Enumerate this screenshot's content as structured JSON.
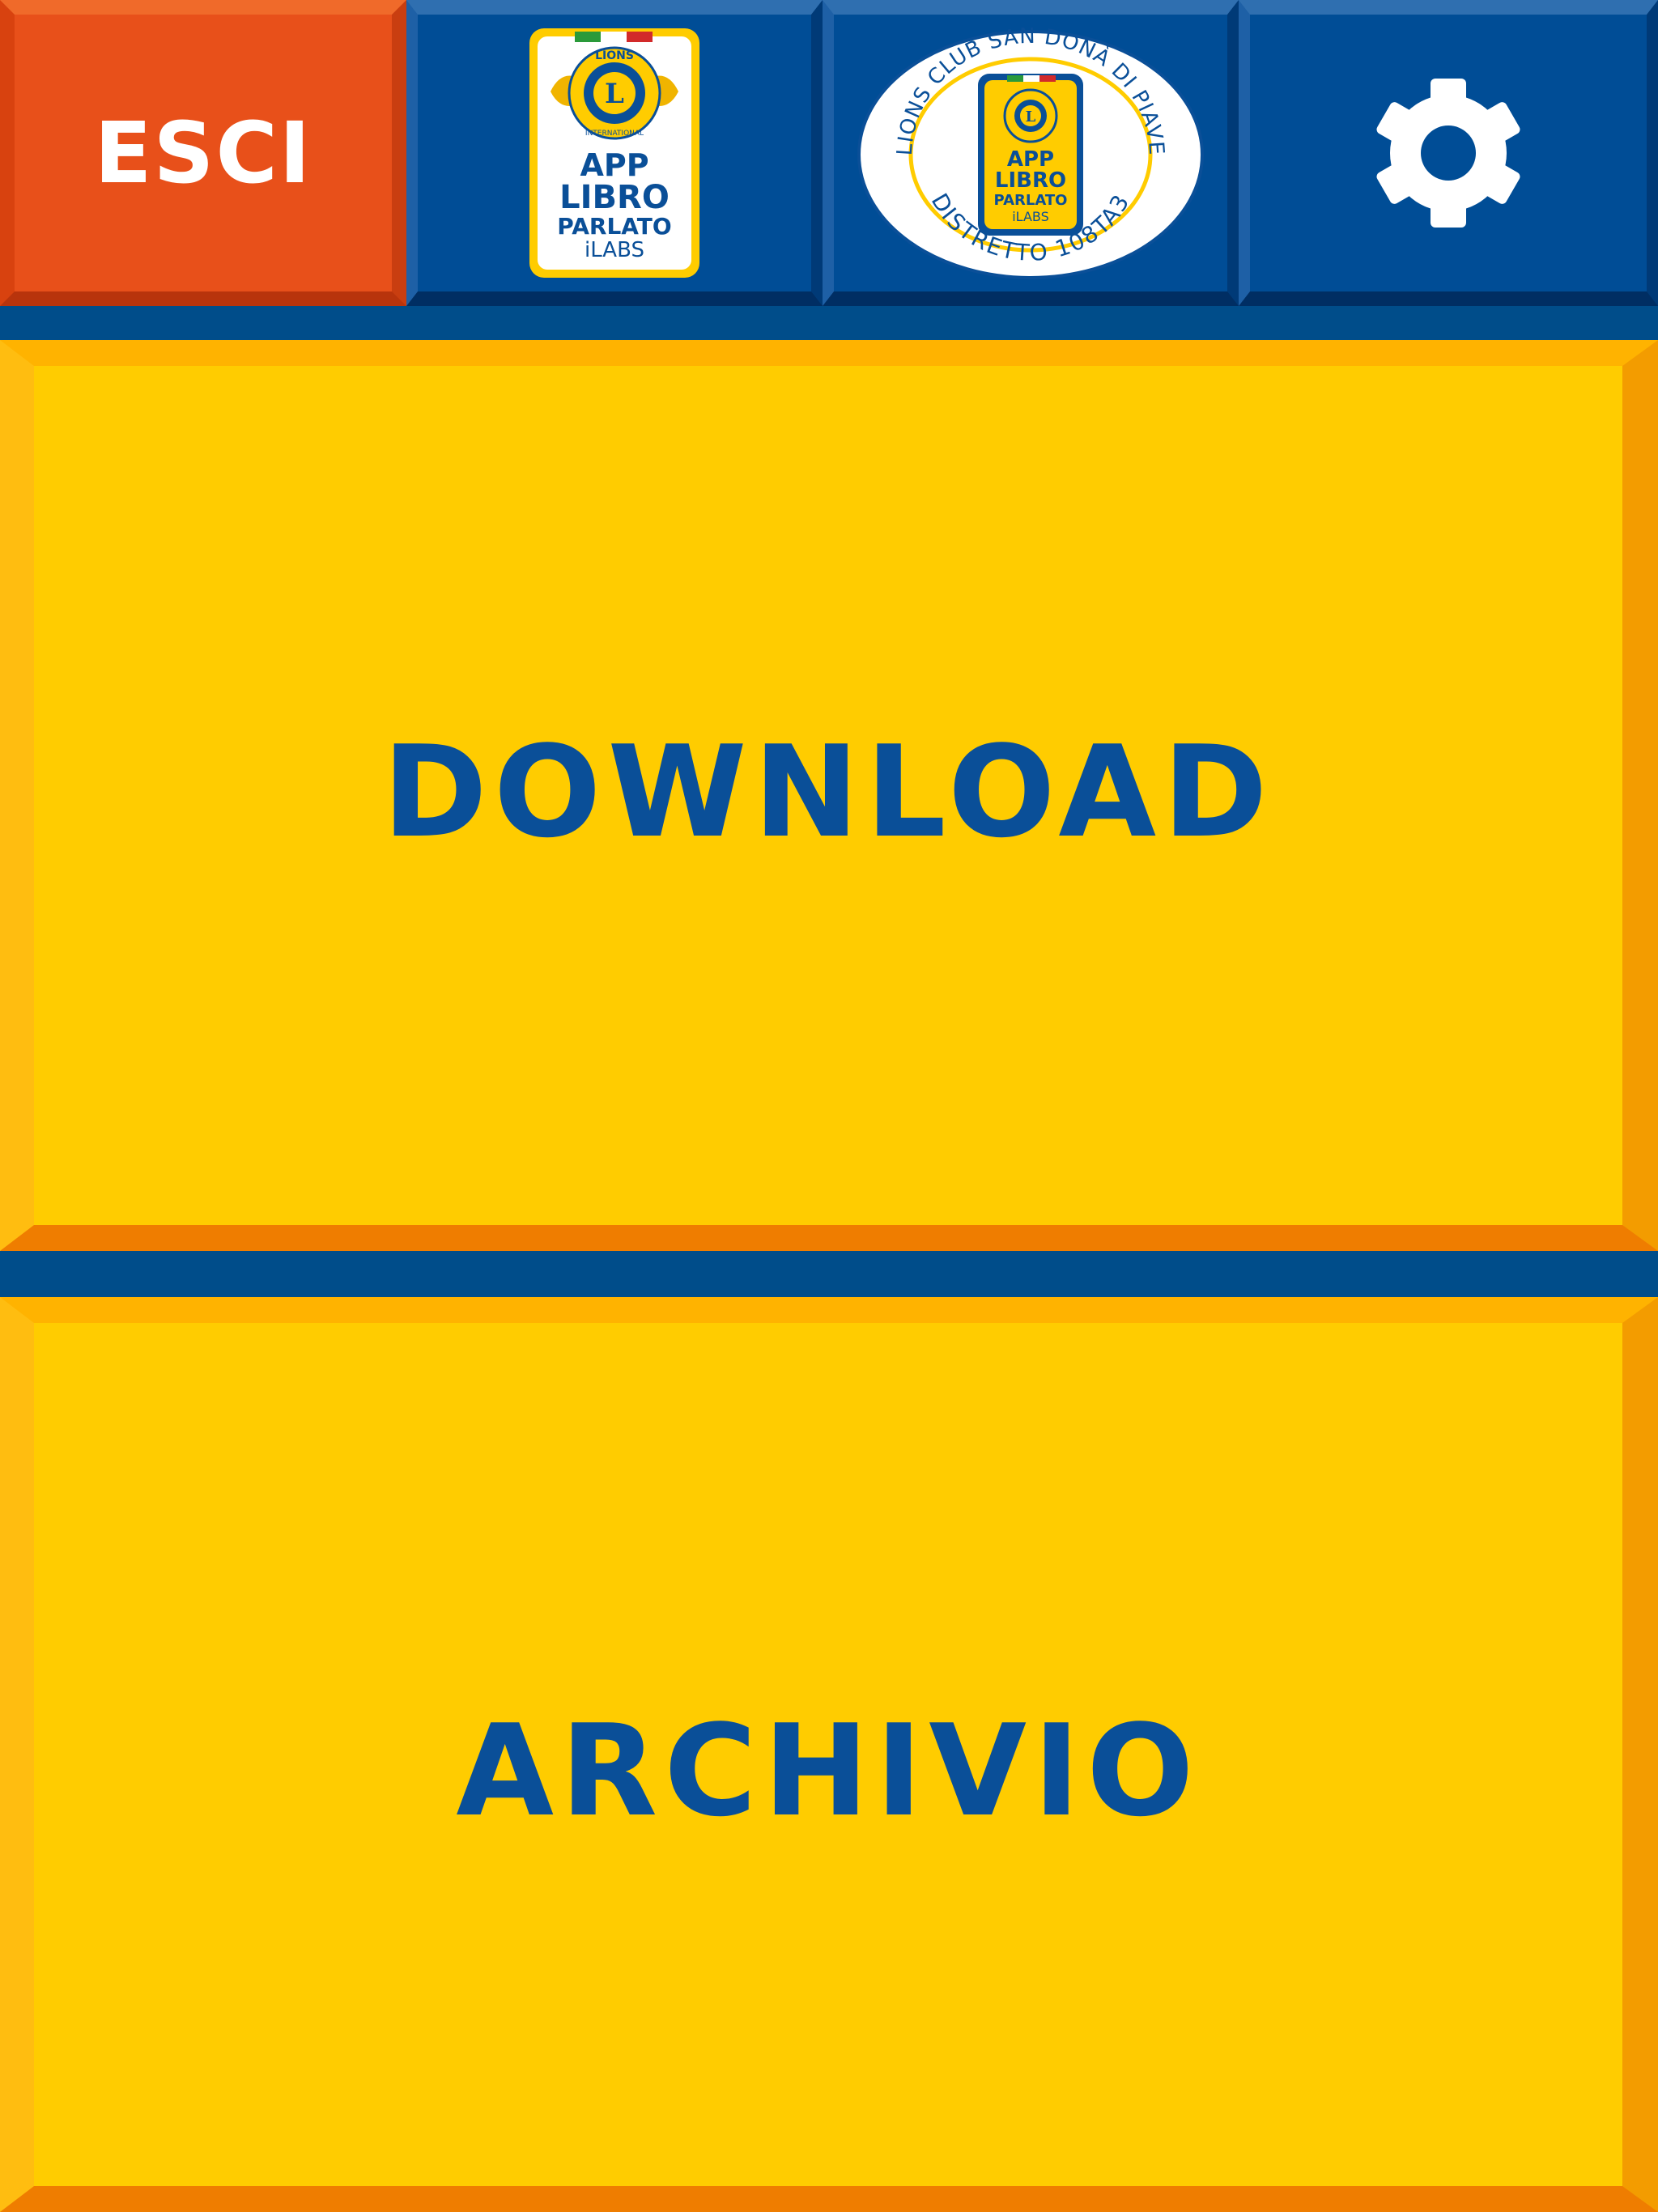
{
  "toolbar": {
    "exit_label": "ESCI",
    "app_logo": {
      "lines": [
        "APP",
        "LIBRO",
        "PARLATO",
        "iLABS"
      ],
      "emblem_top": "LIONS",
      "emblem_bottom": "INTERNATIONAL",
      "emblem_letter": "L"
    },
    "club_logo": {
      "ring_top": "LIONS CLUB SAN DONÀ DI PIAVE",
      "ring_bottom": "DISTRETTO 108TA3"
    },
    "settings_icon": "gear-icon"
  },
  "main": {
    "download_label": "DOWNLOAD",
    "archive_label": "ARCHIVIO"
  },
  "colors": {
    "blue": "#004d96",
    "orange": "#e8501a",
    "yellow": "#ffcc00",
    "label_blue": "#0a4f98"
  }
}
